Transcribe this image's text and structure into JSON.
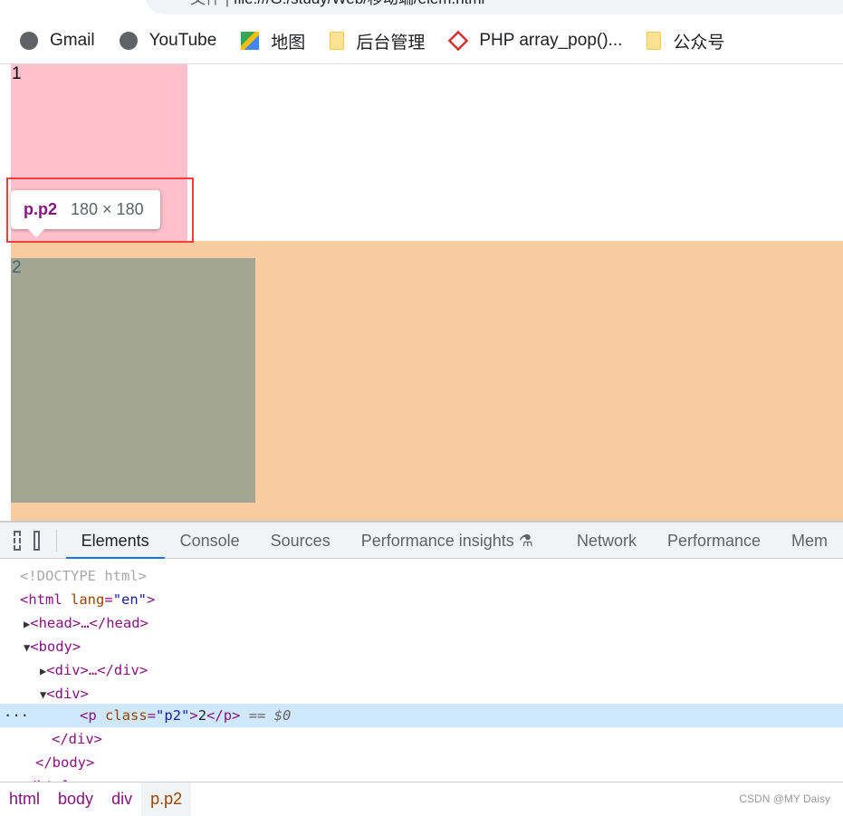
{
  "address_bar": {
    "scheme_label": "文件",
    "url": "file:///G:/study/Web/移动端/elem.html"
  },
  "bookmarks": [
    {
      "label": "Gmail",
      "icon": "globe-icon"
    },
    {
      "label": "YouTube",
      "icon": "globe-icon"
    },
    {
      "label": "地图",
      "icon": "maps-icon"
    },
    {
      "label": "后台管理",
      "icon": "folder-icon"
    },
    {
      "label": "PHP array_pop()...",
      "icon": "php-icon"
    },
    {
      "label": "公众号",
      "icon": "folder-icon"
    }
  ],
  "page": {
    "p1_text": "1",
    "p2_text": "2",
    "colors": {
      "p1": "#ffc0cb",
      "div": "#f8cc9e",
      "p2": "#a1a592"
    }
  },
  "tooltip": {
    "selector": "p.p2",
    "size": "180 × 180"
  },
  "devtools": {
    "tabs": [
      "Elements",
      "Console",
      "Sources",
      "Performance insights",
      "Network",
      "Performance",
      "Mem"
    ],
    "active_tab": "Elements",
    "dom": {
      "doctype": "<!DOCTYPE html>",
      "html_open": "<html",
      "lang_attr": "lang",
      "lang_val": "\"en\"",
      "head": "<head>…</head>",
      "body_open": "<body>",
      "div1": "<div>…</div>",
      "div2_open": "<div>",
      "p_open": "<p",
      "class_attr": "class",
      "class_val": "\"p2\"",
      "p_text": "2",
      "p_close": "</p>",
      "dollar": "== $0",
      "div_close": "</div>",
      "body_close": "</body>",
      "html_close": "</html>",
      "ellipsis": "···"
    },
    "breadcrumbs": [
      "html",
      "body",
      "div",
      "p.p2"
    ]
  },
  "watermark": "CSDN @MY Daisy"
}
